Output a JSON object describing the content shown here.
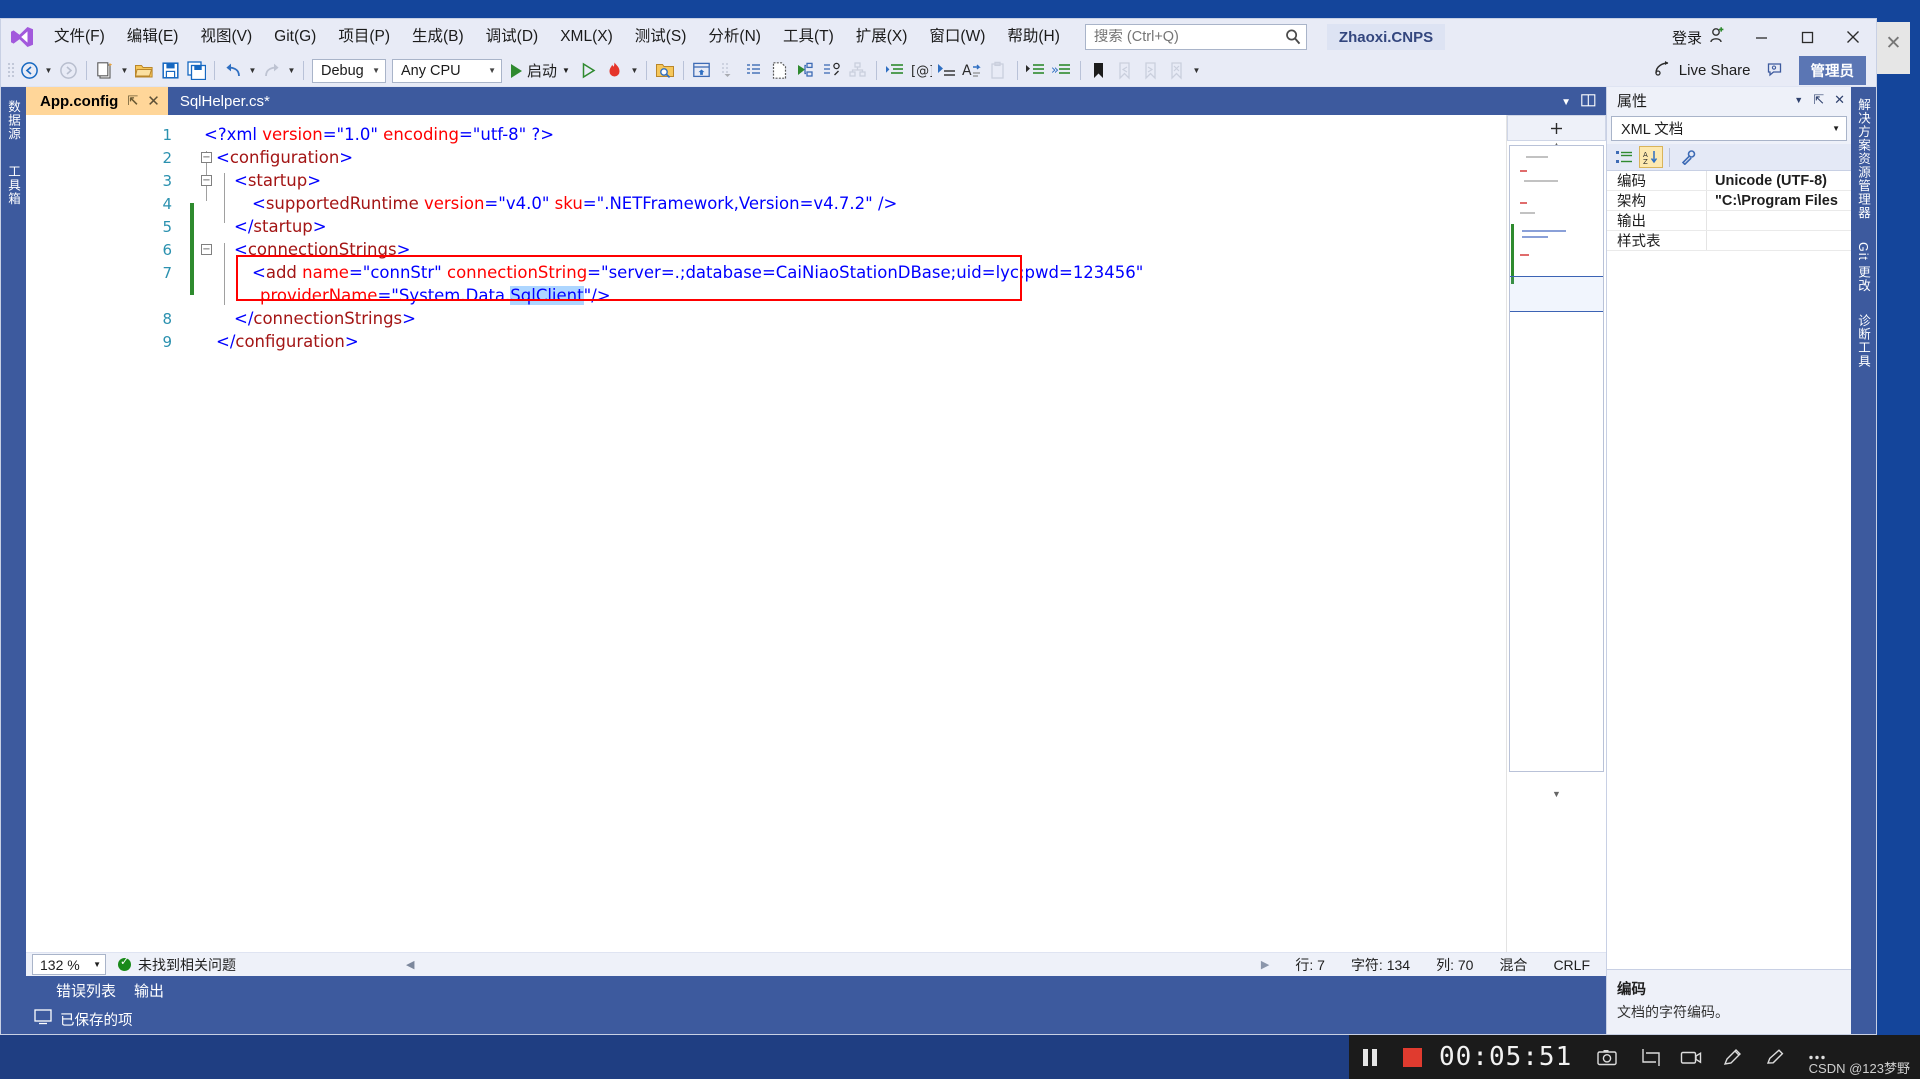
{
  "window": {
    "account_chip": "Zhaoxi.CNPS",
    "signin_label": "登录",
    "minimize": "—",
    "maximize": "▢",
    "close": "✕",
    "outer_close": "✕"
  },
  "menu": {
    "items": [
      {
        "label": "文件(F)",
        "name": "menu-file"
      },
      {
        "label": "编辑(E)",
        "name": "menu-edit"
      },
      {
        "label": "视图(V)",
        "name": "menu-view"
      },
      {
        "label": "Git(G)",
        "name": "menu-git"
      },
      {
        "label": "项目(P)",
        "name": "menu-project"
      },
      {
        "label": "生成(B)",
        "name": "menu-build"
      },
      {
        "label": "调试(D)",
        "name": "menu-debug"
      },
      {
        "label": "XML(X)",
        "name": "menu-xml"
      },
      {
        "label": "测试(S)",
        "name": "menu-test"
      },
      {
        "label": "分析(N)",
        "name": "menu-analyze"
      },
      {
        "label": "工具(T)",
        "name": "menu-tools"
      },
      {
        "label": "扩展(X)",
        "name": "menu-extensions"
      },
      {
        "label": "窗口(W)",
        "name": "menu-window"
      },
      {
        "label": "帮助(H)",
        "name": "menu-help"
      }
    ]
  },
  "search": {
    "placeholder": "搜索 (Ctrl+Q)",
    "value": ""
  },
  "toolbar": {
    "config_value": "Debug",
    "platform_value": "Any CPU",
    "start_label": "启动",
    "live_share_label": "Live Share",
    "admin_label": "管理员"
  },
  "left_dock": {
    "items": [
      "数据源",
      "工具箱"
    ]
  },
  "right_dock": {
    "items": [
      "解决方案资源管理器",
      "Git 更改",
      "诊断工具"
    ]
  },
  "tabs": [
    {
      "label": "App.config",
      "active": true,
      "pin": "⇱",
      "close": "✕"
    },
    {
      "label": "SqlHelper.cs*",
      "active": false
    }
  ],
  "editor": {
    "lines": [
      {
        "num": "1",
        "indent": 1
      },
      {
        "num": "2",
        "indent": 0
      },
      {
        "num": "3",
        "indent": 1
      },
      {
        "num": "4",
        "indent": 2
      },
      {
        "num": "5",
        "indent": 1
      },
      {
        "num": "6",
        "indent": 1
      },
      {
        "num": "7",
        "indent": 2
      },
      {
        "num": "8",
        "indent": 1
      },
      {
        "num": "9",
        "indent": 0
      }
    ],
    "code": {
      "l1": "<?xml version=\"1.0\" encoding=\"utf-8\" ?>",
      "l2": "<configuration>",
      "l3": "<startup>",
      "l4": "<supportedRuntime version=\"v4.0\" sku=\".NETFramework,Version=v4.7.2\" />",
      "l5": "</startup>",
      "l6": "<connectionStrings>",
      "l7a": "<add name=\"connStr\" connectionString=\"server=.;database=CaiNiaoStationDBase;uid=lyc;pwd=123456\"",
      "l7b": "providerName=\"System.Data.SqlClient\"/>",
      "l7b_selected": "SqlClient",
      "l8": "</connectionStrings>",
      "l9": "</configuration>"
    }
  },
  "editor_status": {
    "zoom": "132 %",
    "problems": "未找到相关问题",
    "row": "行: 7",
    "chars": "字符: 134",
    "col": "列: 70",
    "mode": "混合",
    "eol": "CRLF"
  },
  "properties": {
    "title": "属性",
    "selector": "XML 文档",
    "rows": [
      {
        "name": "编码",
        "value": "Unicode (UTF-8)"
      },
      {
        "name": "架构",
        "value": "\"C:\\Program Files"
      },
      {
        "name": "输出",
        "value": ""
      },
      {
        "name": "样式表",
        "value": ""
      }
    ],
    "desc_title": "编码",
    "desc_body": "文档的字符编码。"
  },
  "bottom_dock": {
    "items": [
      "错误列表",
      "输出"
    ]
  },
  "save_bar": {
    "text": "已保存的项"
  },
  "recorder": {
    "time": "00:05:51"
  },
  "watermark": "CSDN @123梦野",
  "colors": {
    "accent_blue": "#3d5a9e",
    "chrome": "#e8ebf6",
    "tab_active": "#ffd699",
    "xml_tag": "#a31515",
    "xml_attr": "#ff0000",
    "xml_value": "#0000ff",
    "highlight": "#add6ff",
    "error_box": "#ff0000",
    "admin_chip": "#5b76b4",
    "record_red": "#e03b2f"
  }
}
